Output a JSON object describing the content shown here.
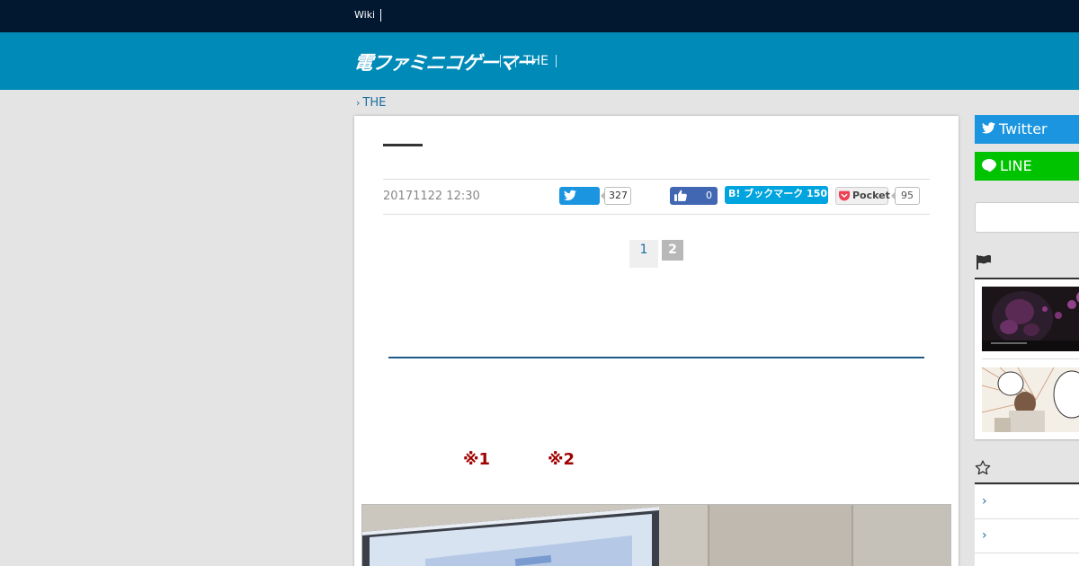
{
  "topbar": {
    "wiki_label": "Wiki"
  },
  "header": {
    "logo_text": "電ファミニコゲーマー",
    "nav_items": [
      "",
      "",
      "THE",
      ""
    ]
  },
  "breadcrumb": {
    "label": "THE"
  },
  "article": {
    "date": "20171122 12:30",
    "share": {
      "twitter_count": "327",
      "facebook_count": "0",
      "hatena_label": "B! ブックマーク 150",
      "pocket_label": "Pocket",
      "pocket_count": "95"
    },
    "pager": {
      "current": "1",
      "next": "2"
    },
    "notes": [
      "※1",
      "※2"
    ]
  },
  "sidebar": {
    "twitter_label": "Twitter",
    "line_label": "LINE",
    "search_placeholder": "",
    "ranking_list": [
      {
        "alt": ""
      },
      {
        "alt": ""
      }
    ],
    "list_items": [
      "",
      ""
    ]
  },
  "colors": {
    "topbar": "#011830",
    "header": "#008ab8",
    "twitter": "#1b95e0",
    "line": "#00c300",
    "facebook": "#4267b2",
    "hatena": "#00a4de",
    "note_red": "#a00000"
  }
}
